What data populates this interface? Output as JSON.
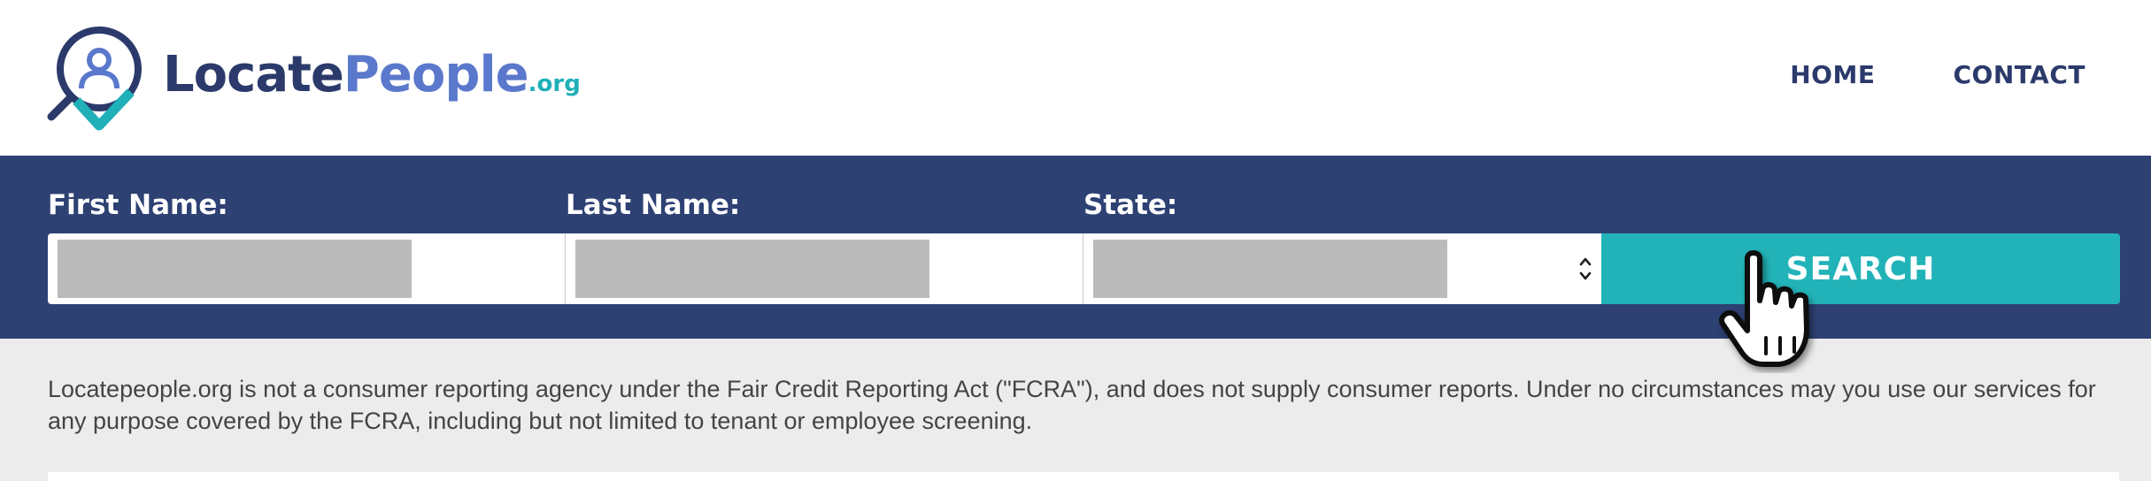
{
  "brand": {
    "name_part1": "Locate",
    "name_part2": "People",
    "tld": ".org",
    "colors": {
      "dark_navy": "#2b3a6b",
      "periwinkle": "#5a78cc",
      "teal": "#1fb0b8"
    }
  },
  "nav": {
    "items": [
      {
        "label": "HOME"
      },
      {
        "label": "CONTACT"
      }
    ]
  },
  "search_form": {
    "band_color": "#2e4173",
    "first_name": {
      "label": "First Name:",
      "value": ""
    },
    "last_name": {
      "label": "Last Name:",
      "value": ""
    },
    "state": {
      "label": "State:",
      "value": ""
    },
    "button": {
      "label": "SEARCH",
      "color": "#22b3b8"
    }
  },
  "icons": {
    "logo_mark": "magnifier-person-check-icon",
    "select_arrows": "updown-chevron-icon",
    "cursor": "hand-pointer-cursor-icon"
  },
  "disclaimer": {
    "text": "Locatepeople.org is not a consumer reporting agency under the Fair Credit Reporting Act (\"FCRA\"), and does not supply consumer reports. Under no circumstances may you use our services for any purpose covered by the FCRA, including but not limited to tenant or employee screening."
  }
}
